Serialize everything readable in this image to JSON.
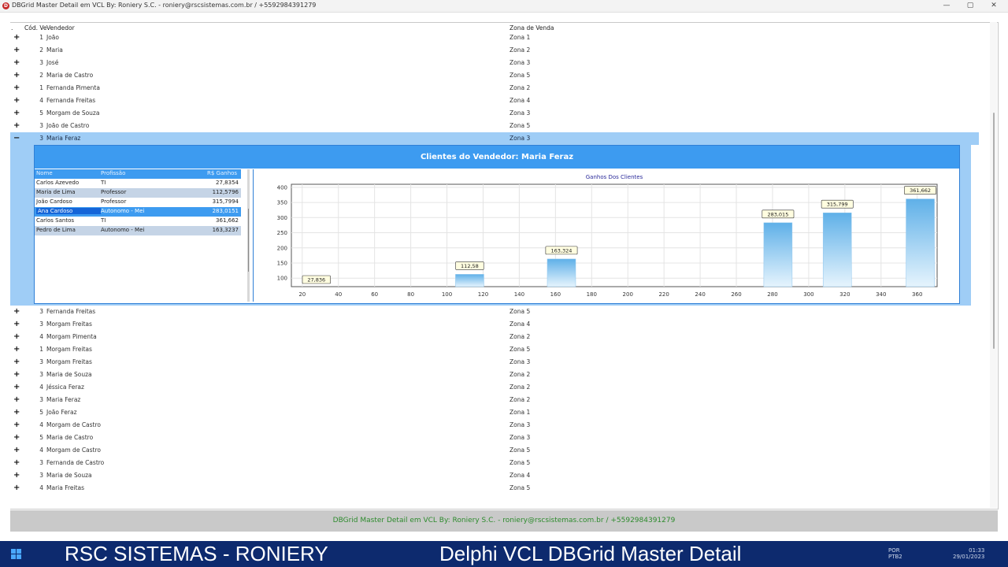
{
  "window": {
    "title": "DBGrid Master Detail em VCL By: Roniery S.C. - roniery@rscsistemas.com.br / +5592984391279",
    "app_icon": "D",
    "minimize_icon": "minimize-icon",
    "maximize_icon": "maximize-icon",
    "close_icon": "close-icon"
  },
  "master": {
    "headers": {
      "marker": ".",
      "cod": "Cód. Ve",
      "vendedor": "Vendedor",
      "zona": "Zona de Venda"
    },
    "rows_top": [
      {
        "pm": "+",
        "cod": "1",
        "nome": "João",
        "zona": "Zona 1"
      },
      {
        "pm": "+",
        "cod": "2",
        "nome": "Maria",
        "zona": "Zona 2"
      },
      {
        "pm": "+",
        "cod": "3",
        "nome": "José",
        "zona": "Zona 3"
      },
      {
        "pm": "+",
        "cod": "2",
        "nome": "Maria de Castro",
        "zona": "Zona 5"
      },
      {
        "pm": "+",
        "cod": "1",
        "nome": "Fernanda Pimenta",
        "zona": "Zona 2"
      },
      {
        "pm": "+",
        "cod": "4",
        "nome": "Fernanda Freitas",
        "zona": "Zona 4"
      },
      {
        "pm": "+",
        "cod": "5",
        "nome": "Morgam de Souza",
        "zona": "Zona 3"
      },
      {
        "pm": "+",
        "cod": "3",
        "nome": "João de Castro",
        "zona": "Zona 5"
      }
    ],
    "selected_row": {
      "pm": "−",
      "cod": "3",
      "nome": "Maria Feraz",
      "zona": "Zona 3"
    },
    "rows_bottom": [
      {
        "pm": "+",
        "cod": "3",
        "nome": "Fernanda Freitas",
        "zona": "Zona 5"
      },
      {
        "pm": "+",
        "cod": "3",
        "nome": "Morgam Freitas",
        "zona": "Zona 4"
      },
      {
        "pm": "+",
        "cod": "4",
        "nome": "Morgam Pimenta",
        "zona": "Zona 2"
      },
      {
        "pm": "+",
        "cod": "1",
        "nome": "Morgam Freitas",
        "zona": "Zona 5"
      },
      {
        "pm": "+",
        "cod": "3",
        "nome": "Morgam Freitas",
        "zona": "Zona 3"
      },
      {
        "pm": "+",
        "cod": "3",
        "nome": "Maria de Souza",
        "zona": "Zona 2"
      },
      {
        "pm": "+",
        "cod": "4",
        "nome": "Jéssica Feraz",
        "zona": "Zona 2"
      },
      {
        "pm": "+",
        "cod": "3",
        "nome": "Maria Feraz",
        "zona": "Zona 2"
      },
      {
        "pm": "+",
        "cod": "5",
        "nome": "João Feraz",
        "zona": "Zona 1"
      },
      {
        "pm": "+",
        "cod": "4",
        "nome": "Morgam de Castro",
        "zona": "Zona 3"
      },
      {
        "pm": "+",
        "cod": "5",
        "nome": "Maria de Castro",
        "zona": "Zona 3"
      },
      {
        "pm": "+",
        "cod": "4",
        "nome": "Morgam de Castro",
        "zona": "Zona 5"
      },
      {
        "pm": "+",
        "cod": "3",
        "nome": "Fernanda de Castro",
        "zona": "Zona 5"
      },
      {
        "pm": "+",
        "cod": "3",
        "nome": "Maria de Souza",
        "zona": "Zona 4"
      },
      {
        "pm": "+",
        "cod": "4",
        "nome": "Maria Freitas",
        "zona": "Zona 5"
      }
    ]
  },
  "detail": {
    "banner": "Clientes do Vendedor: Maria Feraz",
    "headers": {
      "nome": "Nome",
      "profissao": "Profissão",
      "ganhos": "R$ Ganhos"
    },
    "rows": [
      {
        "nome": "Carlos Azevedo",
        "profissao": "TI",
        "ganhos": "27,8354"
      },
      {
        "nome": "Maria de Lima",
        "profissao": "Professor",
        "ganhos": "112,5796"
      },
      {
        "nome": "João Cardoso",
        "profissao": "Professor",
        "ganhos": "315,7994"
      },
      {
        "nome": "Ana Cardoso",
        "profissao": "Autonomo - Mei",
        "ganhos": "283,0151"
      },
      {
        "nome": "Carlos Santos",
        "profissao": "TI",
        "ganhos": "361,662"
      },
      {
        "nome": "Pedro de Lima",
        "profissao": "Autonomo - Mei",
        "ganhos": "163,3237"
      }
    ],
    "selected_index": 3
  },
  "chart_data": {
    "type": "bar",
    "title": "Ganhos Dos Clientes",
    "xlabel": "",
    "ylabel": "",
    "x": [
      27.8354,
      112.5796,
      163.3237,
      283.0151,
      315.7994,
      361.662
    ],
    "values": [
      27.8354,
      112.5796,
      163.3237,
      283.0151,
      315.7994,
      361.662
    ],
    "data_labels": [
      "27,836",
      "112,58",
      "163,324",
      "283,015",
      "315,799",
      "361,662"
    ],
    "x_ticks": [
      "20",
      "40",
      "60",
      "80",
      "100",
      "120",
      "140",
      "160",
      "180",
      "200",
      "220",
      "240",
      "260",
      "280",
      "300",
      "320",
      "340",
      "360"
    ],
    "y_ticks": [
      "100",
      "150",
      "200",
      "250",
      "300",
      "350",
      "400"
    ],
    "xlim": [
      14,
      371
    ],
    "ylim": [
      72,
      410
    ],
    "grid": true,
    "bar_color": "#5fb0e8"
  },
  "statusbar": {
    "text": "DBGrid Master Detail em VCL By: Roniery S.C. - roniery@rscsistemas.com.br / +5592984391279",
    "color": "#2e8b2e"
  },
  "taskbar": {
    "left_caption": "RSC SISTEMAS - RONIERY",
    "right_caption": "Delphi VCL DBGrid Master Detail",
    "start_icon": "windows-start-icon",
    "lang_top": "POR",
    "lang_bottom": "PTB2",
    "time": "01:33",
    "date": "29/01/2023"
  }
}
